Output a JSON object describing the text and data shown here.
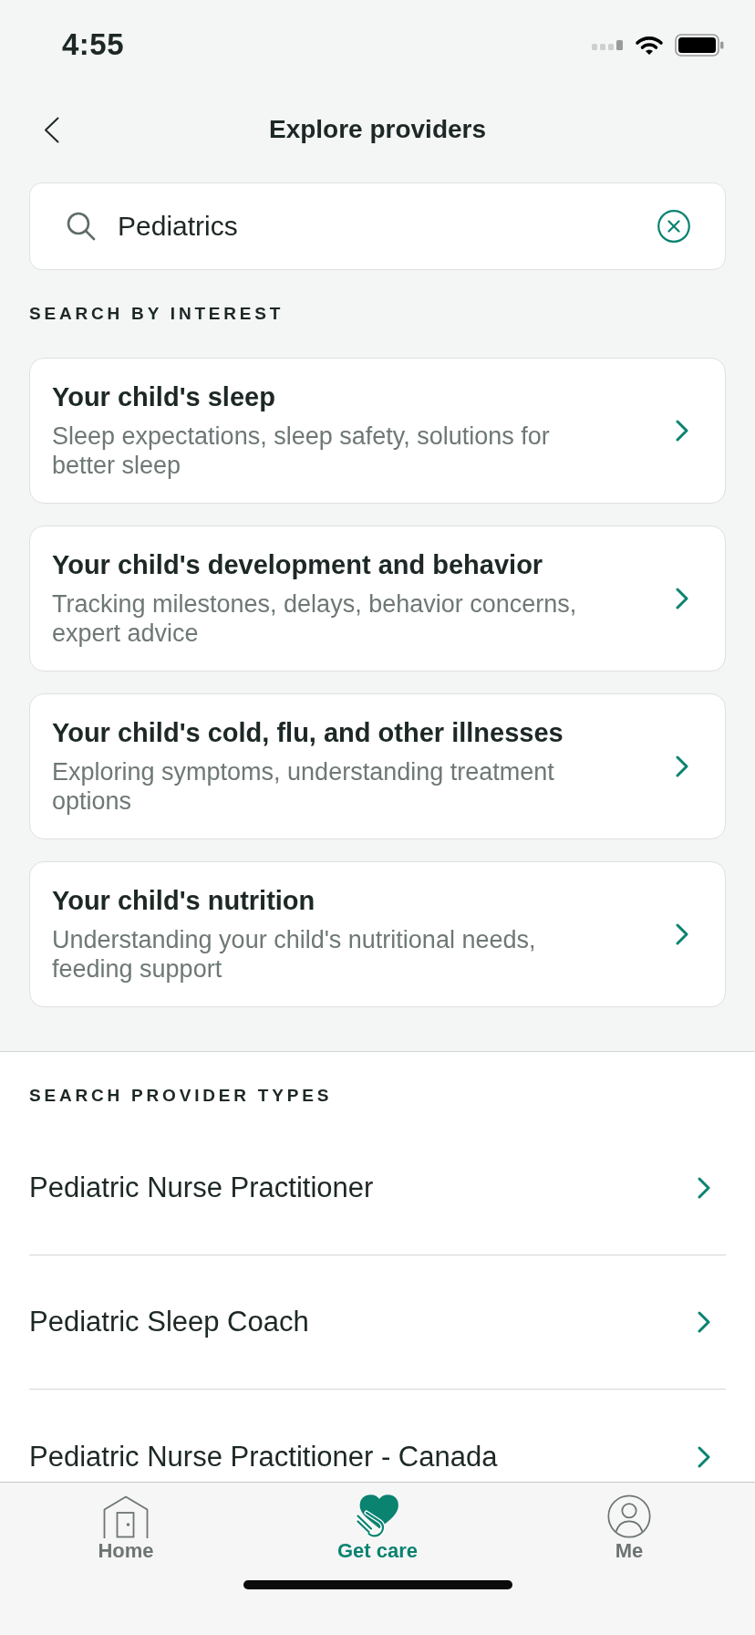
{
  "status_bar": {
    "time": "4:55"
  },
  "header": {
    "title": "Explore providers"
  },
  "search": {
    "value": "Pediatrics"
  },
  "interests": {
    "heading": "SEARCH BY INTEREST",
    "items": [
      {
        "title": "Your child's sleep",
        "description": "Sleep expectations, sleep safety, solutions for better sleep"
      },
      {
        "title": "Your child's development and behavior",
        "description": "Tracking milestones, delays, behavior concerns, expert advice"
      },
      {
        "title": "Your child's cold, flu, and other illnesses",
        "description": "Exploring symptoms, understanding treatment options"
      },
      {
        "title": "Your child's nutrition",
        "description": "Understanding your child's nutritional needs, feeding support"
      }
    ]
  },
  "provider_types": {
    "heading": "SEARCH PROVIDER TYPES",
    "items": [
      "Pediatric Nurse Practitioner",
      "Pediatric Sleep Coach",
      "Pediatric Nurse Practitioner - Canada"
    ]
  },
  "tab_bar": {
    "items": [
      {
        "label": "Home",
        "selected": false
      },
      {
        "label": "Get care",
        "selected": true
      },
      {
        "label": "Me",
        "selected": false
      }
    ]
  }
}
